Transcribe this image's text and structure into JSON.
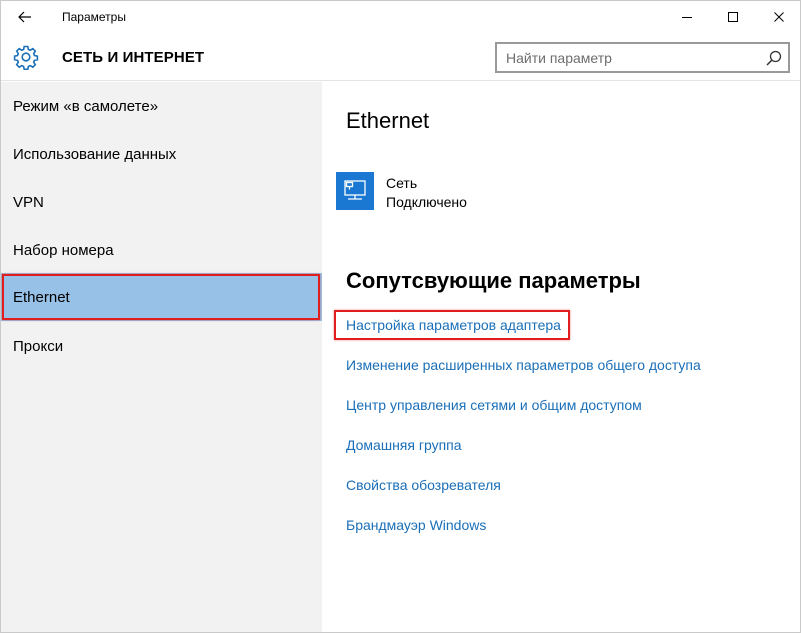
{
  "window": {
    "title": "Параметры"
  },
  "header": {
    "section_title": "СЕТЬ И ИНТЕРНЕТ",
    "search_placeholder": "Найти параметр"
  },
  "sidebar": {
    "items": [
      {
        "label": "Режим «в самолете»",
        "active": false
      },
      {
        "label": "Использование данных",
        "active": false
      },
      {
        "label": "VPN",
        "active": false
      },
      {
        "label": "Набор номера",
        "active": false
      },
      {
        "label": "Ethernet",
        "active": true
      },
      {
        "label": "Прокси",
        "active": false
      }
    ]
  },
  "main": {
    "title": "Ethernet",
    "network": {
      "name": "Сеть",
      "status": "Подключено",
      "icon": "ethernet-monitor-icon"
    },
    "related_title": "Сопутсвующие параметры",
    "links": [
      {
        "label": "Настройка параметров адаптера",
        "highlighted": true
      },
      {
        "label": "Изменение расширенных параметров общего доступа",
        "highlighted": false
      },
      {
        "label": "Центр управления сетями и общим доступом",
        "highlighted": false
      },
      {
        "label": "Домашняя группа",
        "highlighted": false
      },
      {
        "label": "Свойства обозревателя",
        "highlighted": false
      },
      {
        "label": "Брандмауэр Windows",
        "highlighted": false
      }
    ]
  },
  "colors": {
    "accent": "#1a78d2",
    "link": "#1a6fb8",
    "sidebar_bg": "#f2f2f2",
    "active_item_bg": "#97c1e6",
    "highlight_border": "#e21d1d"
  }
}
